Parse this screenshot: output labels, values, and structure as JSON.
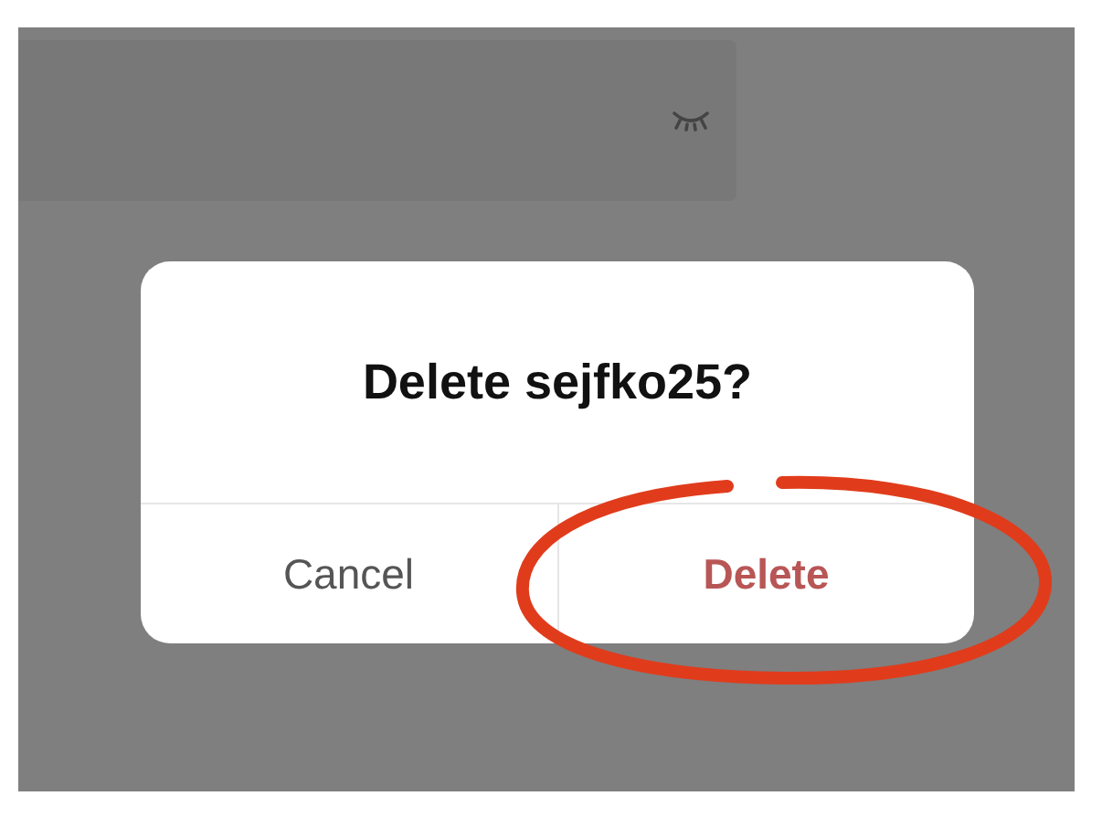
{
  "password_field": {
    "masked": true
  },
  "dialog": {
    "title": "Delete sejfko25?",
    "buttons": [
      {
        "label": "Cancel",
        "kind": "cancel",
        "circled": false
      },
      {
        "label": "Delete",
        "kind": "destructive",
        "circled": true
      }
    ]
  }
}
